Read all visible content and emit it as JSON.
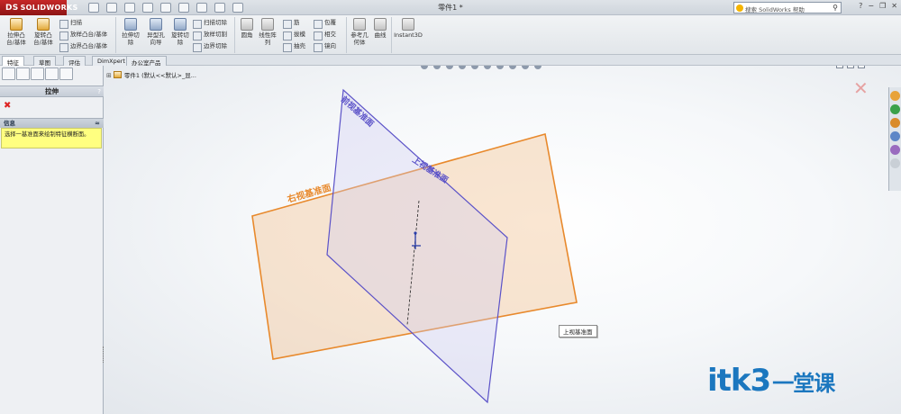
{
  "titlebar": {
    "brand": "SOLIDWORKS",
    "brand_mark": "DS",
    "document_title": "零件1 *",
    "search_placeholder": "搜索 SolidWorks 帮助",
    "window_controls": [
      "?",
      "−",
      "❐",
      "✕"
    ]
  },
  "command_manager": {
    "large_buttons": [
      {
        "label1": "拉伸凸",
        "label2": "台/基体",
        "icon": "extrude-boss-icon"
      },
      {
        "label1": "旋转凸",
        "label2": "台/基体",
        "icon": "revolve-boss-icon"
      },
      {
        "label1": "拉伸切",
        "label2": "除",
        "icon": "extrude-cut-icon"
      },
      {
        "label1": "异型孔",
        "label2": "向导",
        "icon": "hole-wizard-icon"
      },
      {
        "label1": "旋转切",
        "label2": "除",
        "icon": "revolve-cut-icon"
      },
      {
        "label1": "圆角",
        "label2": "",
        "icon": "fillet-icon"
      },
      {
        "label1": "线性阵",
        "label2": "列",
        "icon": "linear-pattern-icon"
      },
      {
        "label1": "参考几",
        "label2": "何体",
        "icon": "reference-geometry-icon"
      },
      {
        "label1": "曲线",
        "label2": "",
        "icon": "curves-icon"
      },
      {
        "label1": "Instant3D",
        "label2": "",
        "icon": "instant3d-icon"
      }
    ],
    "small_group_1": [
      "扫描",
      "放样凸台/基体",
      "边界凸台/基体"
    ],
    "small_group_2": [
      "扫描切除",
      "放样切割",
      "边界切除"
    ],
    "small_group_3": [
      "筋",
      "拔模",
      "抽壳"
    ],
    "small_group_4": [
      "包覆",
      "相交",
      "镜向"
    ]
  },
  "tabs": [
    "特征",
    "草图",
    "评估",
    "DimXpert",
    "办公室产品"
  ],
  "property_manager": {
    "title": "拉伸",
    "help": "?",
    "cancel": "✖",
    "message_header": "信息",
    "message_chevron": "≈",
    "message_text": "选择一基准面来绘制特征横断面。"
  },
  "feature_tree": {
    "expand": "⊞",
    "root_label": "零件1 (默认<<默认>_显..."
  },
  "graphics": {
    "plane_front_label": "前视基准面",
    "plane_right_label": "右视基准面",
    "plane_top_label": "上视基准面",
    "tooltip": "上视基准面",
    "hud_close": "✕",
    "watermark_latin": "itk3",
    "watermark_cn": "一堂课"
  },
  "colors": {
    "front_plane": "#5b52c8",
    "right_plane": "#e8892c",
    "watermark": "#1b77bf",
    "brand_red": "#b71c1c"
  }
}
